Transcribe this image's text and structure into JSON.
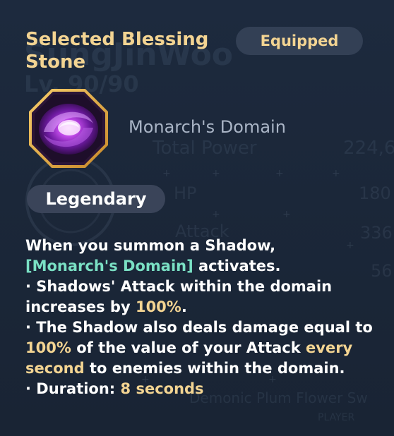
{
  "panel": {
    "title": "Selected Blessing Stone",
    "status_badge": "Equipped"
  },
  "stone": {
    "name": "Monarch's Domain",
    "rarity": "Legendary",
    "icon": "purple-swirl-orb-icon",
    "frame_color": "#e0a93c"
  },
  "description": {
    "line1_a": "When you summon a Shadow,",
    "line1_hl": "[Monarch's Domain]",
    "line1_b": " activates.",
    "b1_a": "· Shadows' Attack within the domain increases by ",
    "b1_hl": "100%",
    "b1_b": ".",
    "b2_a": "· The Shadow also deals damage equal to ",
    "b2_hl1": "100%",
    "b2_b": " of the value of your Attack ",
    "b2_hl2": "every second",
    "b2_c": " to enemies within the domain.",
    "b3_a": "· Duration: ",
    "b3_hl": "8 seconds"
  },
  "background": {
    "player_name": "SungJinWoo",
    "level": "Lv. 90/90",
    "total_power_label": "Total Power",
    "total_power_value": "224,6",
    "hp_label": "HP",
    "hp_value": "180",
    "attack_label": "Attack",
    "attack_value": "336",
    "extra_value": "56",
    "weapon_name": "Demonic Plum Flower Sw",
    "player_tag": "PLAYER"
  },
  "colors": {
    "title_gold": "#f3d492",
    "keyword_green": "#7ae0c4",
    "value_gold": "#f3d492",
    "badge_bg": "#334055"
  }
}
